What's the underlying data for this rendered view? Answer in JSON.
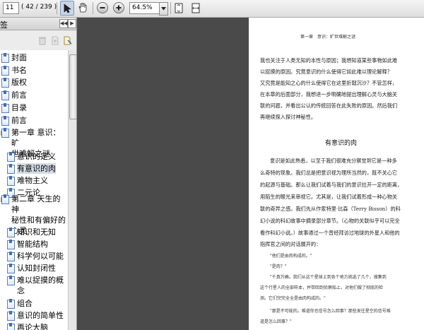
{
  "toolbar": {
    "page_input": "11",
    "page_count": "( 42 / 239 )",
    "zoom": "64.5%",
    "icons": [
      "select-tool-icon",
      "hand-tool-icon",
      "zoom-out-icon",
      "zoom-in-icon",
      "dropdown-icon",
      "fit-page-icon",
      "fit-width-icon"
    ]
  },
  "sidebar": {
    "title": "签",
    "bookmarks": [
      {
        "label": "封面"
      },
      {
        "label": "书名"
      },
      {
        "label": "版权"
      },
      {
        "label": "前言"
      },
      {
        "label": "目录"
      },
      {
        "label": "前言"
      },
      {
        "label": "第一章 意识：旷",
        "label2": "世难解之谜"
      },
      {
        "label": "意识的定义"
      },
      {
        "label": "有意识的肉"
      },
      {
        "label": "难物主义"
      },
      {
        "label": "二元论"
      },
      {
        "label": "第二章 天生的神",
        "label2": "秘性和有偏好的",
        "label3": "心灵"
      },
      {
        "label": "知识和无知"
      },
      {
        "label": "智能结构"
      },
      {
        "label": "科学何以可能"
      },
      {
        "label": "认知封闭性"
      },
      {
        "label": "难以捉摸的概",
        "label2": "念"
      },
      {
        "label": "组合"
      },
      {
        "label": "意识的简单性"
      },
      {
        "label": "再论大脑"
      }
    ]
  },
  "page": {
    "running_head": "第一章　意识：旷世难解之谜",
    "lines": [
      "我也关注于人类无知的本性与原因；我想知道某些事物如此难",
      "以捉摸的原因。究竟意识的什么使得它如此难以理论解释？",
      "又究竟是能知之心的什么使得它在这里折戟沉沙？不管怎样，",
      "在本章的后面部分，我想进一步明确地提出理解心灵与大脑关",
      "联的问题，并看出公认的传统回答在此失败的原因。然后我们",
      "再继续探入探讨神秘性。"
    ],
    "section_title": "有意识的肉",
    "lines2": [
      "意识是如此熟悉，以至于我们很难充分察觉到它是一种多",
      "么奇特的现象。我们总是把意识视为理所当然的，既不关心它",
      "的起源与基础。那么让我们试着与我们的意识拉开一定的距离，",
      "用陌生的眼光来审视它。尤其是，让我们试着形成一种心物关",
      "联的奇异之感。我们先从作家特里·比森（Terry Bisson）的科",
      "幻小说的科幻故事中摘录部分章节。（心物的关联似乎可以完全",
      "看作科幻小说。）故事通过一个曾经拜访过地球的外星人和他的",
      "指挥官之间的对话展开的："
    ],
    "dialog": [
      "\"他们是由肉构成的。\"",
      "\"是肉？\"",
      "\"千真万确。我们从这个星球上到各个地方挑选了几个，搜集到",
      "这个行星人的全部样本，并带回到侦察船上，对他们做了彻底的检",
      "测。它们完完全全是由肉构成的。\"",
      "\"那是不可能的。难道你也信号怎么回事？那些发往星空的信号难",
      "道是怎么回事？\""
    ]
  }
}
